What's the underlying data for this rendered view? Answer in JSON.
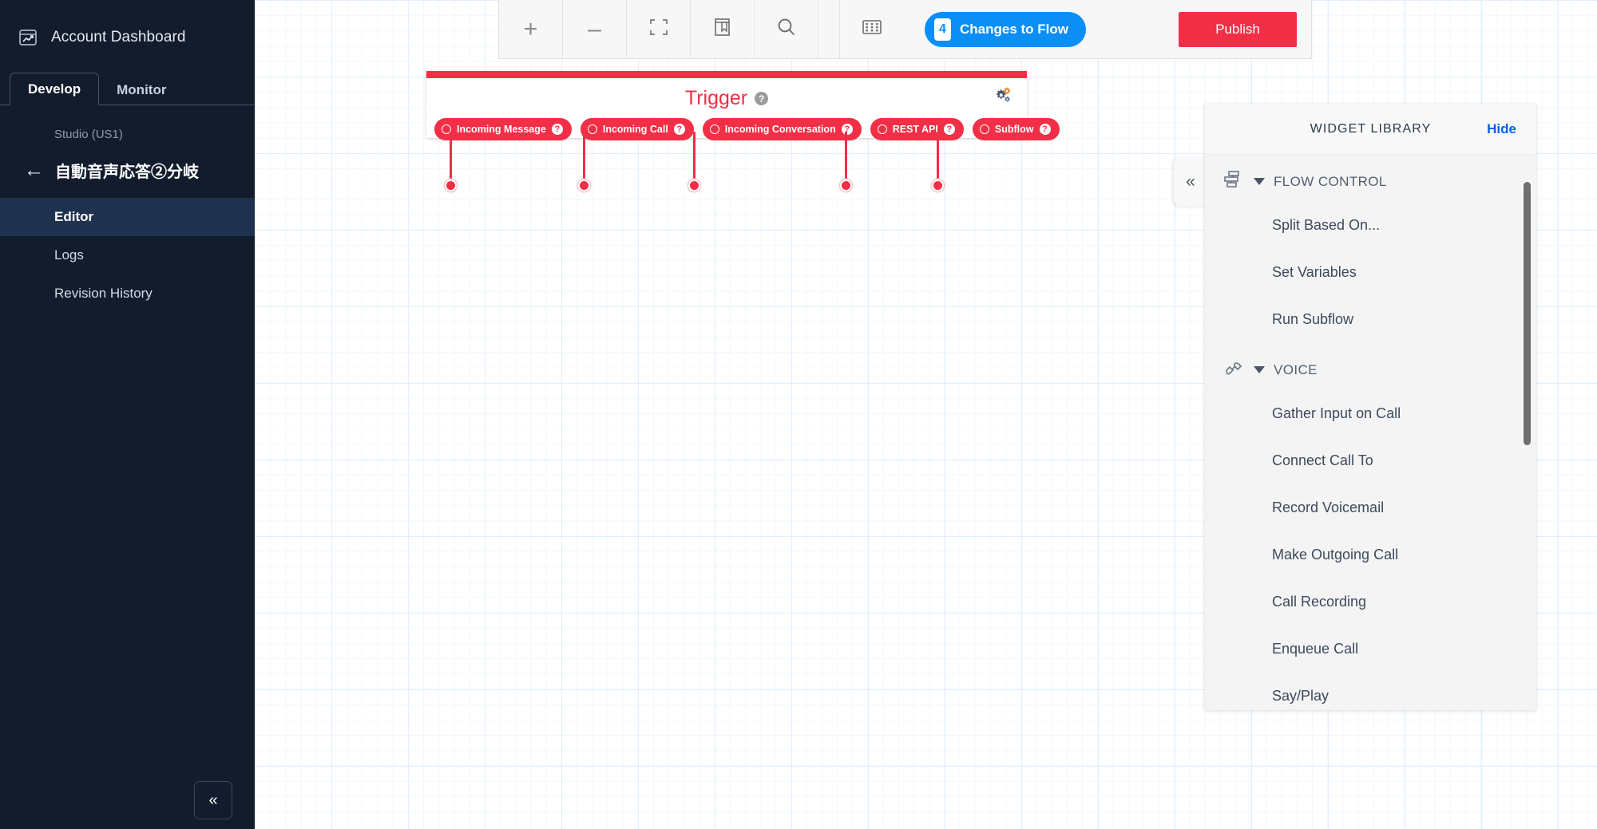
{
  "sidebar": {
    "account_label": "Account Dashboard",
    "account_icon": "chart-window-icon",
    "tabs": [
      {
        "label": "Develop",
        "active": true
      },
      {
        "label": "Monitor",
        "active": false
      }
    ],
    "product_label": "Studio (US1)",
    "back_icon": "arrow-left-icon",
    "flow_title": "自動音声応答②分岐",
    "nav_items": [
      {
        "label": "Editor",
        "active": true
      },
      {
        "label": "Logs",
        "active": false
      },
      {
        "label": "Revision History",
        "active": false
      }
    ],
    "collapse_icon": "«"
  },
  "toolbar": {
    "zoom_in": "+",
    "zoom_out": "–",
    "fit_icon": "fit-screen-icon",
    "library_icon": "book-bookmark-icon",
    "search_icon": "search-icon",
    "keypad_icon": "keypad-grid-icon",
    "changes_count": "4",
    "changes_label": "Changes to Flow",
    "publish_label": "Publish"
  },
  "trigger": {
    "title": "Trigger",
    "help_glyph": "?",
    "gear_icon": "gears-icon",
    "pills": [
      {
        "label": "Incoming Message"
      },
      {
        "label": "Incoming Call"
      },
      {
        "label": "Incoming Conversation"
      },
      {
        "label": "REST API"
      },
      {
        "label": "Subflow"
      }
    ]
  },
  "widget_library": {
    "title": "WIDGET LIBRARY",
    "hide_label": "Hide",
    "collapse_icon": "«",
    "groups": [
      {
        "label": "FLOW CONTROL",
        "icon": "flow-control-icon",
        "items": [
          {
            "label": "Split Based On..."
          },
          {
            "label": "Set Variables"
          },
          {
            "label": "Run Subflow"
          }
        ]
      },
      {
        "label": "VOICE",
        "icon": "phone-handset-icon",
        "items": [
          {
            "label": "Gather Input on Call"
          },
          {
            "label": "Connect Call To"
          },
          {
            "label": "Record Voicemail"
          },
          {
            "label": "Make Outgoing Call"
          },
          {
            "label": "Call Recording"
          },
          {
            "label": "Enqueue Call"
          },
          {
            "label": "Say/Play"
          }
        ]
      }
    ]
  },
  "colors": {
    "brand_red": "#f22f46",
    "accent_blue": "#0c8ef7",
    "link_blue": "#0263e0",
    "sidebar_bg": "#121c2d",
    "sidebar_active": "#1e3250"
  }
}
